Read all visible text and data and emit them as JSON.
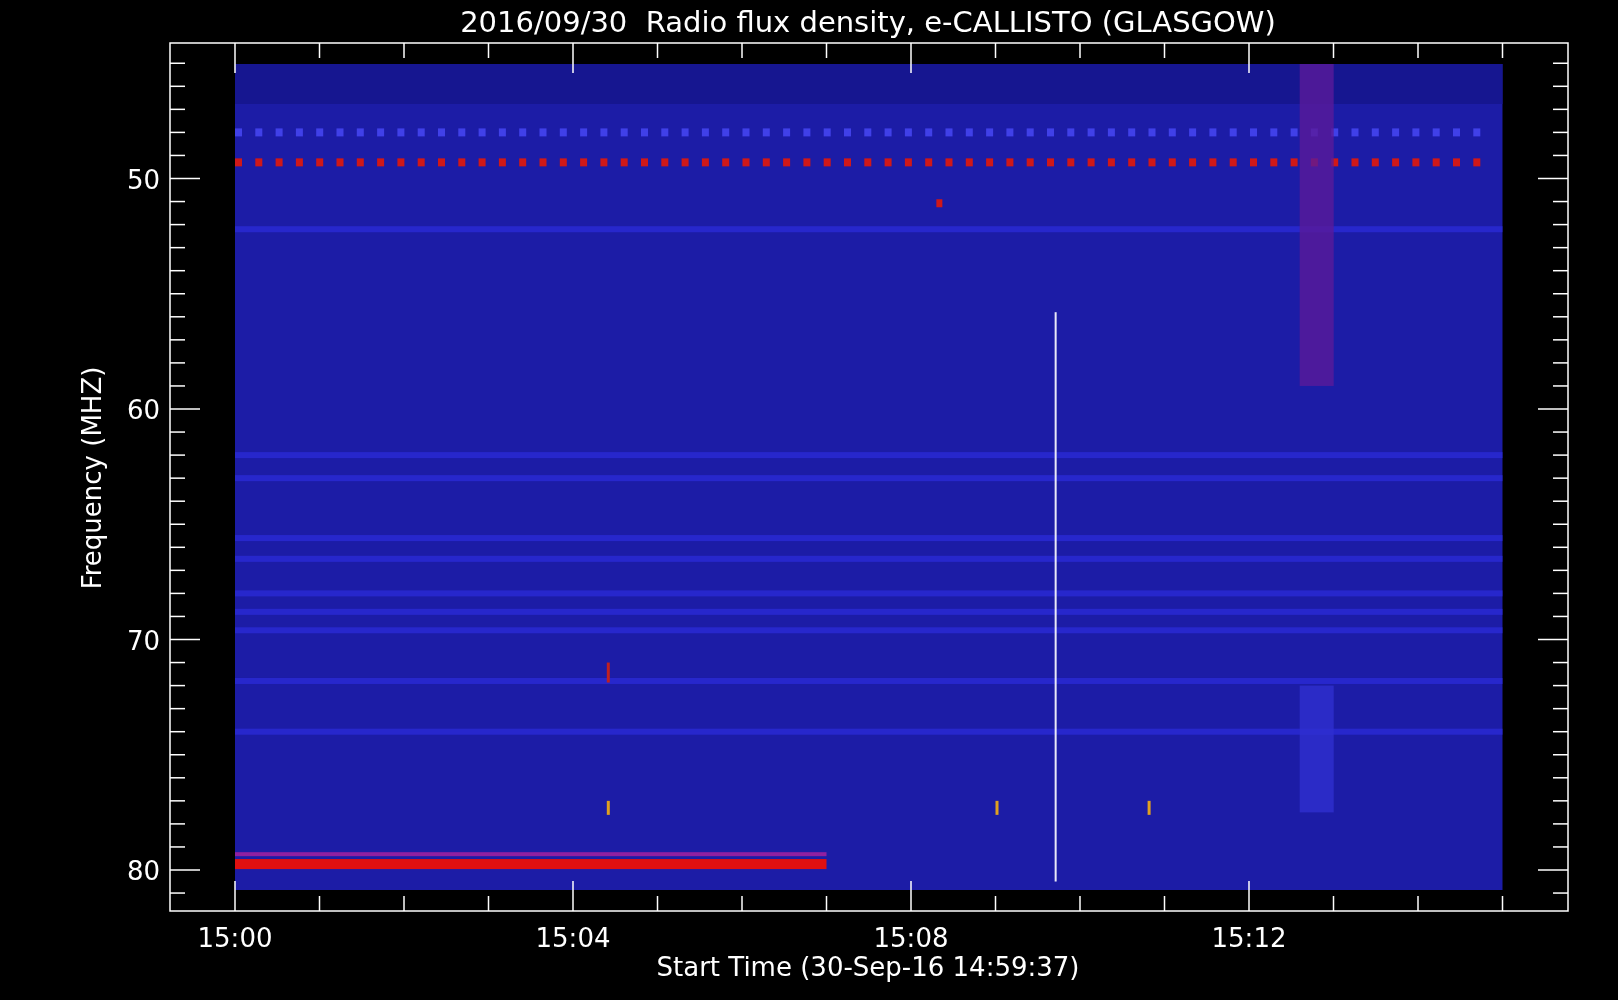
{
  "title": "2016/09/30  Radio flux density, e-CALLISTO (GLASGOW)",
  "x_axis": {
    "label": "Start Time (30-Sep-16 14:59:37)",
    "ticks": [
      "15:00",
      "15:04",
      "15:08",
      "15:12"
    ]
  },
  "y_axis": {
    "label": "Frequency (MHZ)",
    "ticks": [
      "50",
      "60",
      "70",
      "80"
    ]
  }
}
